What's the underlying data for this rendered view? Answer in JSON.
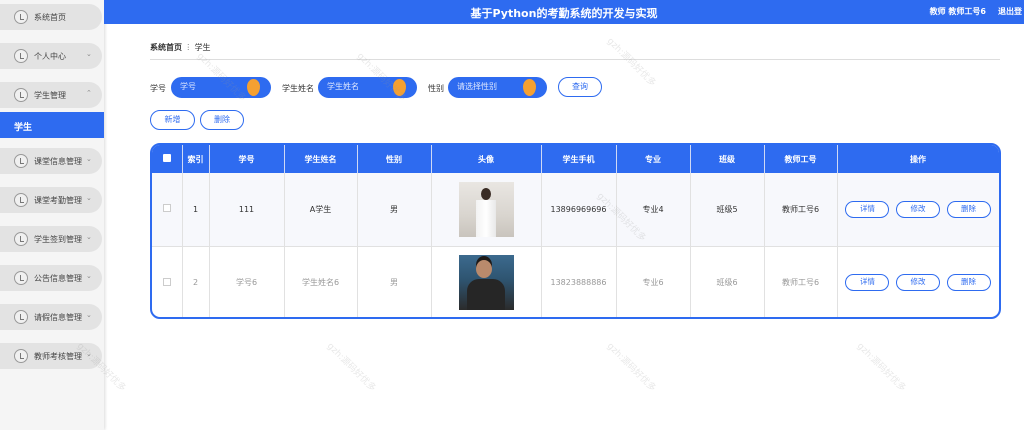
{
  "header": {
    "title": "基于Python的考勤系统的开发与实现",
    "user_info": "教师 教师工号6",
    "logout": "退出登"
  },
  "sidebar": {
    "items": [
      {
        "label": "系统首页"
      },
      {
        "label": "个人中心",
        "chevron": "⌄"
      },
      {
        "label": "学生管理",
        "chevron": "⌃"
      },
      {
        "label": "课堂信息管理",
        "chevron": "⌄"
      },
      {
        "label": "课堂考勤管理",
        "chevron": "⌄"
      },
      {
        "label": "学生签到管理",
        "chevron": "⌄"
      },
      {
        "label": "公告信息管理",
        "chevron": "⌄"
      },
      {
        "label": "请假信息管理",
        "chevron": "⌄"
      },
      {
        "label": "教师考核管理",
        "chevron": "⌄"
      }
    ],
    "active_sub": "学生"
  },
  "breadcrumb": {
    "home": "系统首页",
    "sep": "ⵗ",
    "current": "学生"
  },
  "search": {
    "fields": [
      {
        "label": "学号",
        "placeholder": "学号"
      },
      {
        "label": "学生姓名",
        "placeholder": "学生姓名"
      },
      {
        "label": "性别",
        "placeholder": "请选择性别"
      }
    ],
    "query_label": "查询"
  },
  "actions": {
    "add_label": "新增",
    "delete_label": "删除"
  },
  "table": {
    "headers": [
      "",
      "索引",
      "学号",
      "学生姓名",
      "性别",
      "头像",
      "学生手机",
      "专业",
      "班级",
      "教师工号",
      "操作"
    ],
    "rows": [
      {
        "index": "1",
        "student_no": "111",
        "name": "A学生",
        "gender": "男",
        "phone": "13896969696",
        "major": "专业4",
        "class": "班级5",
        "teacher_no": "教师工号6"
      },
      {
        "index": "2",
        "student_no": "学号6",
        "name": "学生姓名6",
        "gender": "男",
        "phone": "13823888886",
        "major": "专业6",
        "class": "班级6",
        "teacher_no": "教师工号6"
      }
    ],
    "op_labels": {
      "detail": "详情",
      "edit": "修改",
      "delete": "删除"
    }
  },
  "watermark_text": "gzh:源码好优多",
  "colors": {
    "primary": "#2e6bf0",
    "accent": "#f5a031"
  }
}
